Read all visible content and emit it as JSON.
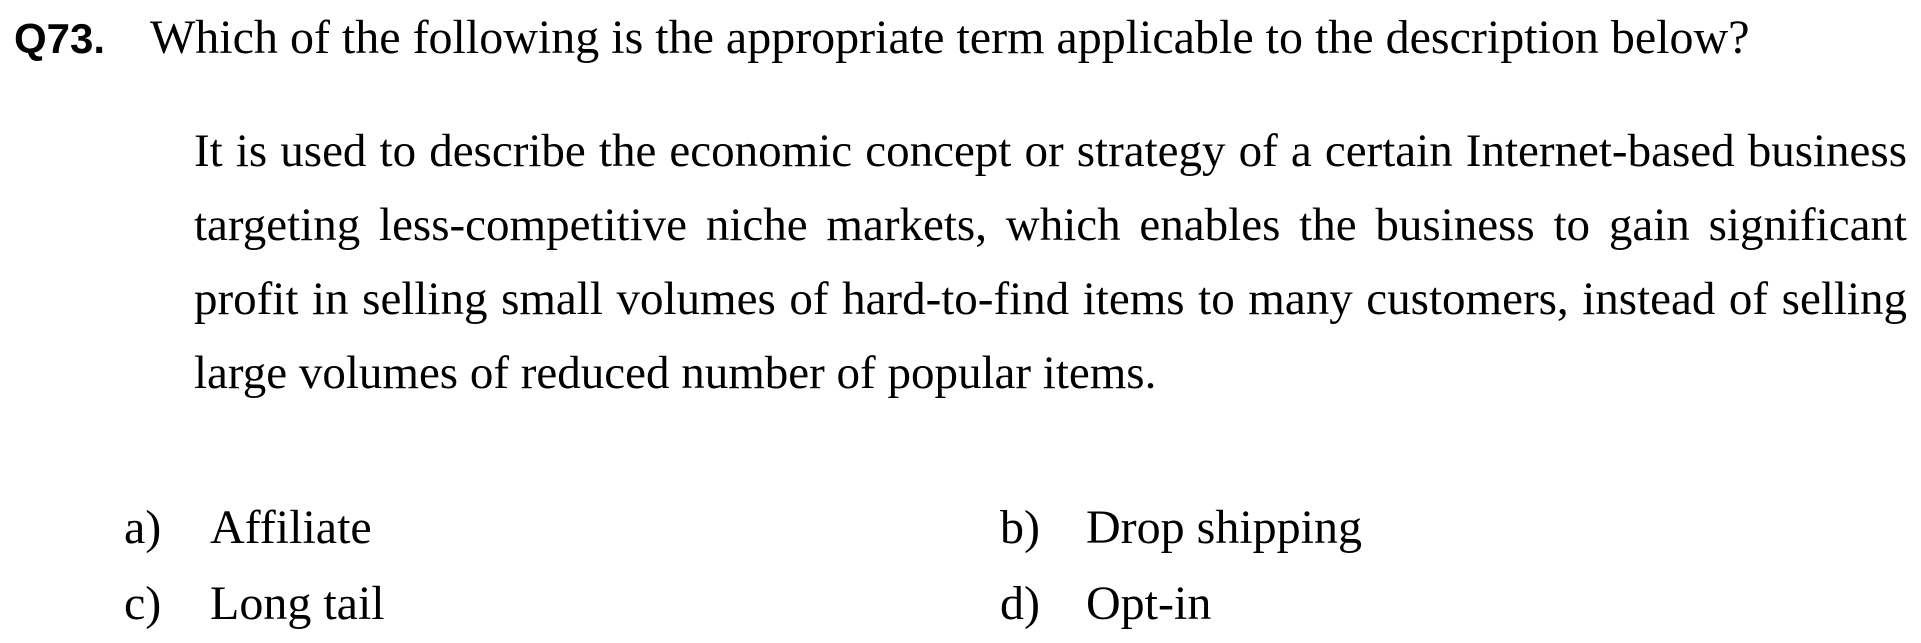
{
  "question": {
    "number": "Q73.",
    "text": "Which of the following is the appropriate term applicable to the description below?"
  },
  "description": "It is used to describe the economic concept or strategy of a certain Internet-based business targeting less-competitive niche markets, which enables the business to gain significant profit in selling small volumes of hard-to-find items to many customers, instead of selling large volumes of reduced number of popular items.",
  "choices": [
    {
      "letter": "a)",
      "text": "Affiliate"
    },
    {
      "letter": "b)",
      "text": "Drop shipping"
    },
    {
      "letter": "c)",
      "text": "Long tail"
    },
    {
      "letter": "d)",
      "text": "Opt-in"
    }
  ]
}
